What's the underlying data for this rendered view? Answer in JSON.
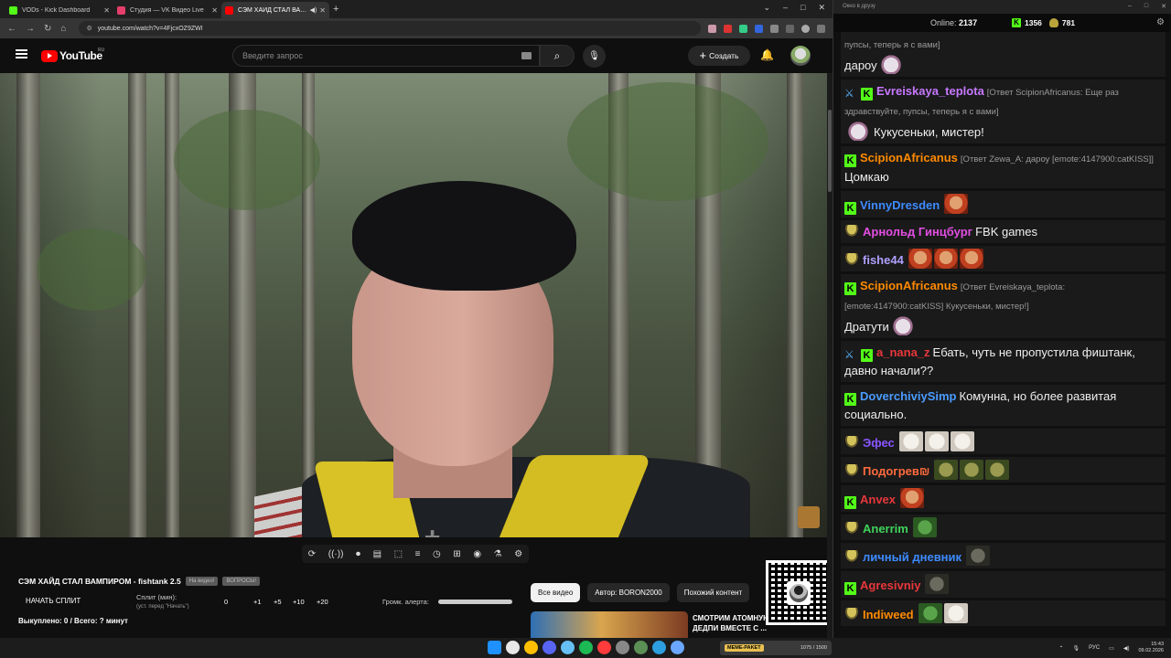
{
  "browser": {
    "tabs": [
      {
        "title": "VODs - Kick Dashboard",
        "favicon_color": "#53fc18",
        "active": false
      },
      {
        "title": "Студия — VK Видео Live",
        "favicon_color": "#e53e6b",
        "active": false
      },
      {
        "title": "СЭМ ХАЙД СТАЛ ВАМПИРОМ",
        "favicon_color": "#ff0000",
        "active": true
      }
    ],
    "new_tab": "+",
    "window_controls": [
      "⌄",
      "–",
      "□",
      "✕"
    ],
    "url": "youtube.com/watch?v=4FjcxOZ9ZWI"
  },
  "youtube": {
    "logo_text": "YouTube",
    "country": "RU",
    "search_placeholder": "Введите запрос",
    "create_label": "Создать",
    "video": {
      "title": "СЭМ ХАЙД СТАЛ ВАМПИРОМ - fishtank 2.5",
      "chips": [
        "На видео!",
        "ВОПРОСЫ!"
      ],
      "controls": [
        "⟳",
        "((·))",
        "⏺",
        "▤",
        "⬚",
        "≡",
        "◷",
        "⊞",
        "◉",
        "⚗",
        "⚙"
      ]
    },
    "split": {
      "start_label": "НАЧАТЬ СПЛИТ",
      "label": "Сплит (мин):",
      "hint": "(уст. перед \"Начать\")",
      "values": [
        "0",
        "+1",
        "+5",
        "+10",
        "+20"
      ]
    },
    "alert_volume_label": "Громк. алерта:",
    "alert_volume_level": 1.0,
    "bought_label": "Выкуплено: 0 / Всего: ? минут",
    "filters": [
      "Все видео",
      "Автор: BORON2000",
      "Похожий контент"
    ],
    "recommended": {
      "title": "СМОТРИМ АТОМНУЮ БОМБУ ДЕДПИ ВМЕСТЕ С ..."
    }
  },
  "chat": {
    "window_title": "Окно в друзу",
    "window_controls": [
      "–",
      "□",
      "✕"
    ],
    "online_label": "Online:",
    "online_count": "2137",
    "kick_count": "1356",
    "goblin_count": "781",
    "messages": [
      {
        "reply": "пупсы, теперь я с вами]",
        "user": "",
        "color": "#ffffff",
        "badges": [],
        "text": "дароу",
        "emotes": [
          "cat"
        ]
      },
      {
        "user": "Evreiskaya_teplota",
        "color": "#c778ff",
        "badges": [
          "sword",
          "kick"
        ],
        "reply": "[Ответ ScipionAfricanus: Еще раз здравствуйте, пупсы, теперь я с вами]",
        "text": "Кукусеньки, мистер!",
        "emotes": [
          "cat"
        ],
        "emote_first": true
      },
      {
        "user": "ScipionAfricanus",
        "color": "#ff8a00",
        "badges": [
          "kick"
        ],
        "reply": "[Ответ Zewa_A: дароу [emote:4147900:catKISS]]",
        "text": "Цомкаю",
        "emotes": []
      },
      {
        "user": "VinnyDresden",
        "color": "#3d8bff",
        "badges": [
          "kick"
        ],
        "reply": "",
        "text": "",
        "emotes": [
          "face"
        ]
      },
      {
        "user": "Арнольд Гинцбург",
        "color": "#e24ee2",
        "badges": [
          "goblin"
        ],
        "reply": "",
        "text": "FBK games",
        "emotes": []
      },
      {
        "user": "fishe44",
        "color": "#b0a0ff",
        "badges": [
          "goblin"
        ],
        "reply": "",
        "text": "",
        "emotes": [
          "face",
          "face",
          "face"
        ]
      },
      {
        "user": "ScipionAfricanus",
        "color": "#ff8a00",
        "badges": [
          "kick"
        ],
        "reply": "[Ответ Evreiskaya_teplota: [emote:4147900:catKISS] Кукусеньки, мистер!]",
        "text": "Дратути",
        "emotes": [
          "cat"
        ]
      },
      {
        "user": "a_nana_z",
        "color": "#e8373b",
        "badges": [
          "sword",
          "kick"
        ],
        "reply": "",
        "text": "Ебать, чуть не пропустила фиштанк, давно начали??",
        "emotes": []
      },
      {
        "user": "DoverchiviySimp",
        "color": "#4a9cff",
        "badges": [
          "kick"
        ],
        "reply": "",
        "text": "Комунна, но более развитая социально.",
        "emotes": []
      },
      {
        "user": "Эфес",
        "color": "#8a55ff",
        "badges": [
          "goblin"
        ],
        "reply": "",
        "text": "",
        "emotes": [
          "wcat",
          "wcat",
          "wcat"
        ]
      },
      {
        "user": "Подогрев₪",
        "color": "#ff6a3d",
        "badges": [
          "goblin"
        ],
        "reply": "",
        "text": "",
        "emotes": [
          "goblin",
          "goblin",
          "goblin"
        ]
      },
      {
        "user": "Anvex",
        "color": "#e8373b",
        "badges": [
          "kick"
        ],
        "reply": "",
        "text": "",
        "emotes": [
          "face"
        ]
      },
      {
        "user": "Anerrim",
        "color": "#3fd45a",
        "badges": [
          "goblin"
        ],
        "reply": "",
        "text": "",
        "emotes": [
          "pepe"
        ]
      },
      {
        "user": "личный дневник",
        "color": "#3d8bff",
        "badges": [
          "goblin"
        ],
        "reply": "",
        "text": "",
        "emotes": [
          "dark"
        ]
      },
      {
        "user": "Agresivniy",
        "color": "#e8373b",
        "badges": [
          "kick"
        ],
        "reply": "",
        "text": "",
        "emotes": [
          "dark"
        ]
      },
      {
        "user": "Indiweed",
        "color": "#ff8a00",
        "badges": [
          "goblin"
        ],
        "reply": "",
        "text": "",
        "emotes": [
          "pepe",
          "wcat"
        ]
      }
    ]
  },
  "taskbar": {
    "apps": [
      "#1e90ff",
      "#e8e8e8",
      "#ffbf00",
      "#5865f2",
      "#66c0f4",
      "#1db954",
      "#ff3b3b",
      "#888888",
      "#5b8f55",
      "#2d9ee0",
      "#6aa6ff"
    ],
    "kick_widget": {
      "tag": "MEME-PAKET",
      "progress": "1075 / 1500"
    },
    "lang": "РУС",
    "time": "15:43",
    "date": "09.02.2026"
  }
}
